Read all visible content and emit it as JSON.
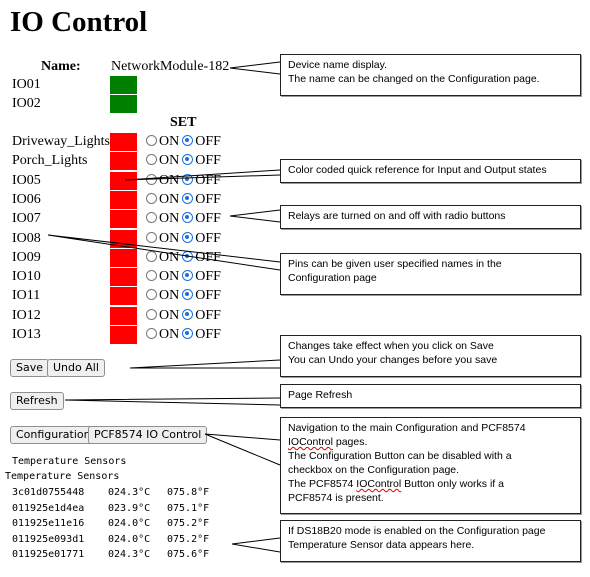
{
  "page": {
    "title": "IO Control"
  },
  "device": {
    "name_label": "Name:",
    "name_value": "NetworkModule-182"
  },
  "inputs": [
    {
      "label": "IO01",
      "state_color": "#008000"
    },
    {
      "label": "IO02",
      "state_color": "#008000"
    }
  ],
  "set_header": "SET",
  "radio_labels": {
    "on": "ON",
    "off": "OFF"
  },
  "outputs": [
    {
      "label": "Driveway_Lights",
      "state_color": "#ff0000",
      "selected": "OFF"
    },
    {
      "label": "Porch_Lights",
      "state_color": "#ff0000",
      "selected": "OFF"
    },
    {
      "label": "IO05",
      "state_color": "#ff0000",
      "selected": "OFF"
    },
    {
      "label": "IO06",
      "state_color": "#ff0000",
      "selected": "OFF"
    },
    {
      "label": "IO07",
      "state_color": "#ff0000",
      "selected": "OFF"
    },
    {
      "label": "IO08",
      "state_color": "#ff0000",
      "selected": "OFF"
    },
    {
      "label": "IO09",
      "state_color": "#ff0000",
      "selected": "OFF"
    },
    {
      "label": "IO10",
      "state_color": "#ff0000",
      "selected": "OFF"
    },
    {
      "label": "IO11",
      "state_color": "#ff0000",
      "selected": "OFF"
    },
    {
      "label": "IO12",
      "state_color": "#ff0000",
      "selected": "OFF"
    },
    {
      "label": "IO13",
      "state_color": "#ff0000",
      "selected": "OFF"
    }
  ],
  "buttons": {
    "save": "Save",
    "undo_all": "Undo All",
    "refresh": "Refresh",
    "configuration": "Configuration",
    "pcf8574": "PCF8574 IO Control"
  },
  "temperature": {
    "heading1": "Temperature Sensors",
    "heading2": "Temperature Sensors",
    "sensors": [
      {
        "id": "3c01d0755448",
        "celsius": "024.3°C",
        "fahrenheit": "075.8°F"
      },
      {
        "id": "011925e1d4ea",
        "celsius": "023.9°C",
        "fahrenheit": "075.1°F"
      },
      {
        "id": "011925e11e16",
        "celsius": "024.0°C",
        "fahrenheit": "075.2°F"
      },
      {
        "id": "011925e093d1",
        "celsius": "024.0°C",
        "fahrenheit": "075.2°F"
      },
      {
        "id": "011925e01771",
        "celsius": "024.3°C",
        "fahrenheit": "075.6°F"
      }
    ]
  },
  "callouts": {
    "device_name": [
      "Device name display.",
      "The name can be changed on the Configuration page."
    ],
    "color_coded": [
      "Color coded quick reference for Input and Output states"
    ],
    "relays": [
      "Relays are turned on and off with radio buttons"
    ],
    "pin_names": [
      "Pins can be given user specified names in the",
      "Configuration page"
    ],
    "save_undo": [
      "Changes take effect when you click on Save",
      "You can Undo your changes before you save"
    ],
    "refresh": [
      "Page Refresh"
    ],
    "navigation": {
      "line1": "Navigation to the main Configuration and PCF8574",
      "line2_word": "IOControl",
      "line2_rest": " pages.",
      "line3": "The Configuration Button can be disabled with a",
      "line4": "checkbox on the Configuration page.",
      "line5_pre": "The PCF8574 ",
      "line5_word": "IOControl",
      "line5_rest": " Button only works if a",
      "line6": "PCF8574 is present."
    },
    "ds18b20": [
      "If DS18B20 mode is enabled on the Configuration page",
      "Temperature Sensor data appears here."
    ]
  }
}
